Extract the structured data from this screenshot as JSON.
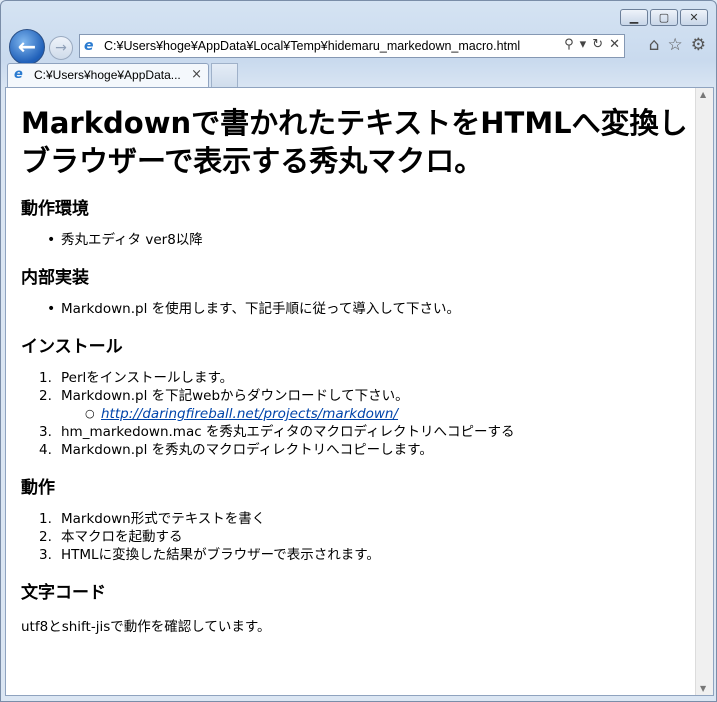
{
  "browser": {
    "url": "C:¥Users¥hoge¥AppData¥Local¥Temp¥hidemaru_markedown_macro.html",
    "tab_label": "C:¥Users¥hoge¥AppData...",
    "tab_close": "×"
  },
  "doc": {
    "title": "Markdownで書かれたテキストをHTMLへ変換しブラウザーで表示する秀丸マクロ。",
    "sections": {
      "env": {
        "heading": "動作環境",
        "items": [
          "秀丸エディタ ver8以降"
        ]
      },
      "impl": {
        "heading": "内部実装",
        "items": [
          "Markdown.pl を使用します、下記手順に従って導入して下さい。"
        ]
      },
      "install": {
        "heading": "インストール",
        "items": [
          "Perlをインストールします。",
          "Markdown.pl を下記webからダウンロードして下さい。",
          "hm_markedown.mac を秀丸エディタのマクロディレクトリへコピーする",
          "Markdown.pl を秀丸のマクロディレクトリへコピーします。"
        ],
        "link": "http://daringfireball.net/projects/markdown/"
      },
      "action": {
        "heading": "動作",
        "items": [
          "Markdown形式でテキストを書く",
          "本マクロを起動する",
          "HTMLに変換した結果がブラウザーで表示されます。"
        ]
      },
      "charset": {
        "heading": "文字コード",
        "text": "utf8とshift-jisで動作を確認しています。"
      }
    }
  }
}
